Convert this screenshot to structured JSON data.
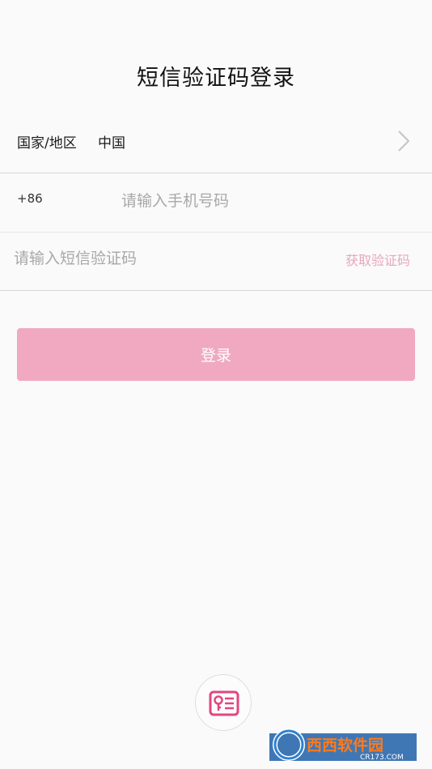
{
  "page": {
    "title": "短信验证码登录"
  },
  "country": {
    "label": "国家/地区",
    "value": "中国"
  },
  "phone": {
    "prefix": "+86",
    "placeholder": "请输入手机号码",
    "value": ""
  },
  "code": {
    "placeholder": "请输入短信验证码",
    "value": "",
    "get_code_label": "获取验证码"
  },
  "login": {
    "label": "登录"
  },
  "icons": {
    "country_chevron": "chevron-right-icon",
    "alt_login": "id-card-key-icon"
  },
  "watermark": {
    "name": "西西软件园",
    "domain": "CR173.COM"
  },
  "colors": {
    "accent": "#e4457f",
    "login_button": "#f0a9c0",
    "link": "#e8a7bd",
    "background": "#fafafa"
  }
}
